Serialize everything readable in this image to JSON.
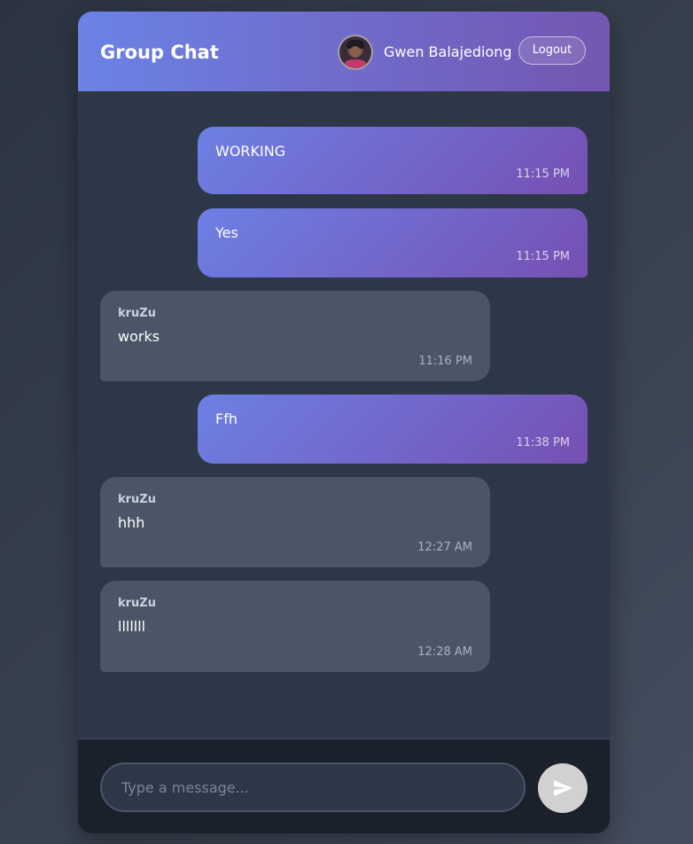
{
  "header": {
    "title": "Group Chat",
    "user_name": "Gwen Balajediong",
    "logout_label": "Logout",
    "avatar_icon": "user-avatar"
  },
  "messages": [
    {
      "own": true,
      "sender": "",
      "text": "WORKING",
      "time": "11:15 PM"
    },
    {
      "own": true,
      "sender": "",
      "text": "Yes",
      "time": "11:15 PM"
    },
    {
      "own": false,
      "sender": "kruZu",
      "text": "works",
      "time": "11:16 PM"
    },
    {
      "own": true,
      "sender": "",
      "text": "Ffh",
      "time": "11:38 PM"
    },
    {
      "own": false,
      "sender": "kruZu",
      "text": "hhh",
      "time": "12:27 AM"
    },
    {
      "own": false,
      "sender": "kruZu",
      "text": "lllllll",
      "time": "12:28 AM"
    }
  ],
  "composer": {
    "placeholder": "Type a message...",
    "value": "",
    "send_icon": "send-icon"
  },
  "colors": {
    "header_gradient_start": "#6b82e6",
    "header_gradient_end": "#7456b0",
    "own_bubble_start": "#6d80e4",
    "own_bubble_end": "#7650b2",
    "other_bubble": "#4a5568",
    "chat_background": "#2d3748",
    "composer_background": "#1a202c",
    "send_button": "#d1d1d1"
  }
}
